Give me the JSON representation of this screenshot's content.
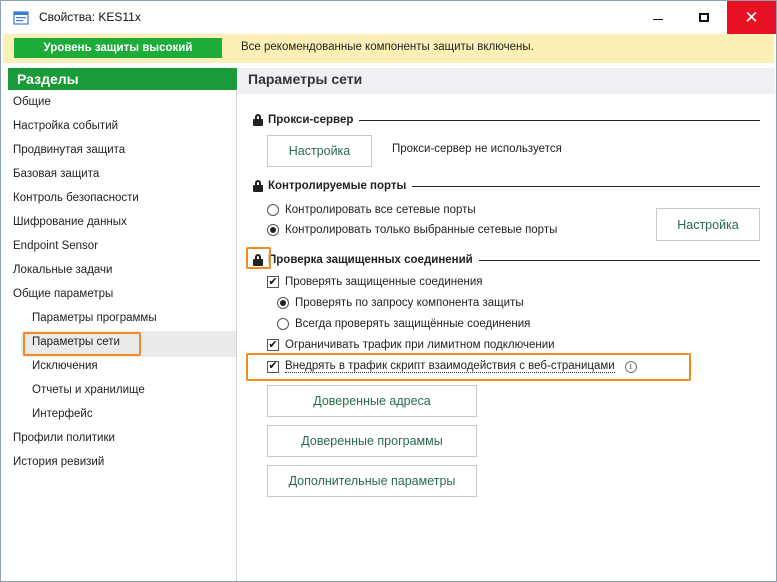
{
  "window": {
    "title": "Свойства: KES11x",
    "controls": {
      "minimize": "minimize",
      "maximize": "maximize",
      "close": "close"
    }
  },
  "notice": {
    "level_badge": "Уровень защиты высокий",
    "text": "Все рекомендованные компоненты защиты включены.",
    "badge_color": "#1dab3a",
    "bg_color": "#fdf0b6"
  },
  "sidebar": {
    "header": "Разделы",
    "header_color": "#1a9b3a",
    "items": [
      {
        "label": "Общие",
        "level": 1
      },
      {
        "label": "Настройка событий",
        "level": 1
      },
      {
        "label": "Продвинутая защита",
        "level": 1
      },
      {
        "label": "Базовая защита",
        "level": 1
      },
      {
        "label": "Контроль безопасности",
        "level": 1
      },
      {
        "label": "Шифрование данных",
        "level": 1
      },
      {
        "label": "Endpoint Sensor",
        "level": 1
      },
      {
        "label": "Локальные задачи",
        "level": 1
      },
      {
        "label": "Общие параметры",
        "level": 1
      },
      {
        "label": "Параметры программы",
        "level": 2
      },
      {
        "label": "Параметры сети",
        "level": 2,
        "selected": true
      },
      {
        "label": "Исключения",
        "level": 2
      },
      {
        "label": "Отчеты и хранилище",
        "level": 2
      },
      {
        "label": "Интерфейс",
        "level": 2
      },
      {
        "label": "Профили политики",
        "level": 1
      },
      {
        "label": "История ревизий",
        "level": 1
      }
    ]
  },
  "main": {
    "title": "Параметры сети",
    "proxy": {
      "title": "Прокси-сервер",
      "button": "Настройка",
      "status": "Прокси-сервер не используется"
    },
    "ports": {
      "title": "Контролируемые порты",
      "options": [
        {
          "label": "Контролировать все сетевые порты",
          "selected": false
        },
        {
          "label": "Контролировать только выбранные сетевые порты",
          "selected": true
        }
      ],
      "button": "Настройка"
    },
    "secure": {
      "title": "Проверка защищенных соединений",
      "check_secure": {
        "label": "Проверять защищенные соединения",
        "checked": true
      },
      "options": [
        {
          "label": "Проверять по запросу компонента защиты",
          "selected": true
        },
        {
          "label": "Всегда проверять защищённые соединения",
          "selected": false
        }
      ],
      "limit_traffic": {
        "label": "Ограничивать трафик при лимитном подключении",
        "checked": true
      },
      "inject_script": {
        "label": "Внедрять в трафик скрипт взаимодействия с веб-страницами",
        "checked": true
      },
      "info_icon": "info-icon",
      "buttons": {
        "trusted_addresses": "Доверенные адреса",
        "trusted_programs": "Доверенные программы",
        "advanced": "Дополнительные параметры"
      }
    }
  },
  "highlight_color": "#f08a24"
}
